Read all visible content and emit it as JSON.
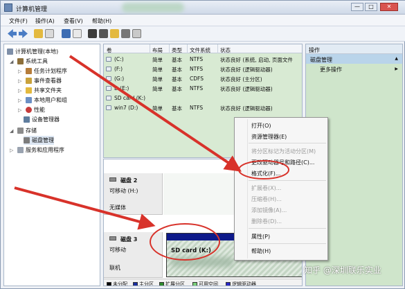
{
  "window": {
    "title": "计算机管理",
    "controls": {
      "minimize": "—",
      "maximize": "□",
      "close": "✕"
    }
  },
  "menu": {
    "items": [
      "文件(F)",
      "操作(A)",
      "查看(V)",
      "帮助(H)"
    ]
  },
  "tree": {
    "root": "计算机管理(本地)",
    "system_tools": "系统工具",
    "task_scheduler": "任务计划程序",
    "event_viewer": "事件查看器",
    "shared_folders": "共享文件夹",
    "local_users": "本地用户和组",
    "performance": "性能",
    "device_manager": "设备管理器",
    "storage": "存储",
    "disk_management": "磁盘管理",
    "services_apps": "服务和应用程序"
  },
  "volume_list": {
    "columns": [
      "卷",
      "布局",
      "类型",
      "文件系统",
      "状态"
    ],
    "rows": [
      {
        "vol": "(C:)",
        "layout": "简单",
        "type": "基本",
        "fs": "NTFS",
        "status": "状态良好 (系统, 启动, 页面文件"
      },
      {
        "vol": "(F:)",
        "layout": "简单",
        "type": "基本",
        "fs": "NTFS",
        "status": "状态良好 (逻辑驱动器)"
      },
      {
        "vol": "(G:)",
        "layout": "简单",
        "type": "基本",
        "fs": "CDFS",
        "status": "状态良好 (主分区)"
      },
      {
        "vol": "D (E:)",
        "layout": "简单",
        "type": "基本",
        "fs": "NTFS",
        "status": "状态良好 (逻辑驱动器)"
      },
      {
        "vol": "SD card (K:)",
        "layout": "",
        "type": "",
        "fs": "",
        "status": ""
      },
      {
        "vol": "win7 (D:)",
        "layout": "简单",
        "type": "基本",
        "fs": "NTFS",
        "status": "状态良好 (逻辑驱动器)"
      }
    ]
  },
  "actions": {
    "header": "操作",
    "section": "磁盘管理",
    "more": "更多操作"
  },
  "disks": {
    "disk2": {
      "name": "磁盘 2",
      "type": "可移动 (H:)",
      "media": "无媒体"
    },
    "disk3": {
      "name": "磁盘 3",
      "type": "可移动",
      "status": "联机",
      "partition_label": "SD card  (K:)"
    }
  },
  "legend": [
    "未分配",
    "主分区",
    "扩展分区",
    "可用空间",
    "逻辑驱动器"
  ],
  "legend_colors": [
    "#000000",
    "#1a2fa0",
    "#2e8b2e",
    "#7ad07a",
    "#2727c8"
  ],
  "context_menu": {
    "items": [
      {
        "label": "打开(O)",
        "disabled": false
      },
      {
        "label": "资源管理器(E)",
        "disabled": false
      },
      {
        "label": "将分区标记为活动分区(M)",
        "disabled": true
      },
      {
        "label": "更改驱动器号和路径(C)...",
        "disabled": false
      },
      {
        "label": "格式化(F)...",
        "disabled": false
      },
      {
        "label": "扩展卷(X)...",
        "disabled": true
      },
      {
        "label": "压缩卷(H)...",
        "disabled": true
      },
      {
        "label": "添加镜像(A)...",
        "disabled": true
      },
      {
        "label": "删除卷(D)...",
        "disabled": true
      },
      {
        "label": "属性(P)",
        "disabled": false
      },
      {
        "label": "帮助(H)",
        "disabled": false
      }
    ]
  },
  "watermark": "知乎 @深圳联乐实业",
  "colors": {
    "annotation_red": "#d8322a",
    "partition_header": "#0e1a8a",
    "volume_bg": "#d8ead3"
  }
}
